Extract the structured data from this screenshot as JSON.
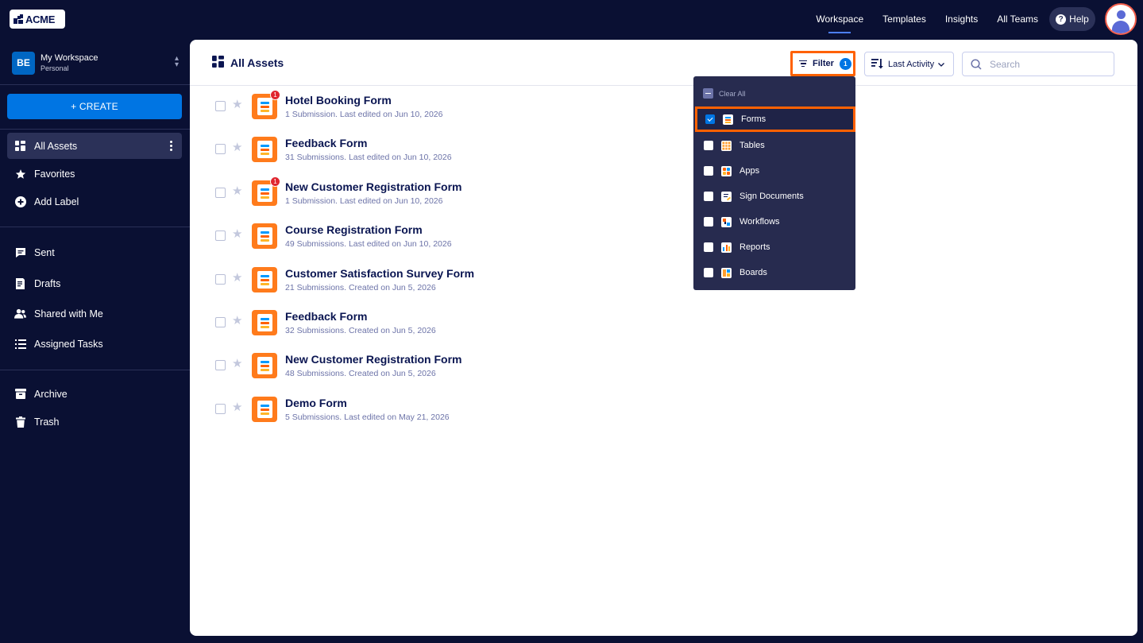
{
  "brand": {
    "logo_text": "ACME"
  },
  "nav": {
    "links": [
      {
        "label": "Workspace",
        "active": true
      },
      {
        "label": "Templates",
        "active": false
      },
      {
        "label": "Insights",
        "active": false
      },
      {
        "label": "All Teams",
        "active": false
      }
    ],
    "help_label": "Help",
    "help_glyph": "?"
  },
  "workspace": {
    "initials": "BE",
    "name": "My Workspace",
    "type": "Personal"
  },
  "sidebar": {
    "create_label": "+ CREATE",
    "items": [
      {
        "label": "All Assets",
        "icon": "grid-icon"
      },
      {
        "label": "Favorites",
        "icon": "star-icon"
      },
      {
        "label": "Add Label",
        "icon": "plus-circle-icon"
      },
      {
        "label": "Sent",
        "icon": "message-icon"
      },
      {
        "label": "Drafts",
        "icon": "draft-icon"
      },
      {
        "label": "Shared with Me",
        "icon": "users-icon"
      },
      {
        "label": "Assigned Tasks",
        "icon": "tasks-icon"
      },
      {
        "label": "Archive",
        "icon": "archive-icon"
      },
      {
        "label": "Trash",
        "icon": "trash-icon"
      }
    ]
  },
  "main": {
    "title": "All Assets",
    "filter_label": "Filter",
    "filter_count": "1",
    "sort_label": "Last Activity",
    "search_placeholder": "Search",
    "assets": [
      {
        "title": "Hotel Booking Form",
        "meta": "1 Submission. Last edited on Jun 10, 2026",
        "badge": "1"
      },
      {
        "title": "Feedback Form",
        "meta": "31 Submissions. Last edited on Jun 10, 2026",
        "badge": ""
      },
      {
        "title": "New Customer Registration Form",
        "meta": "1 Submission. Last edited on Jun 10, 2026",
        "badge": "1"
      },
      {
        "title": "Course Registration Form",
        "meta": "49 Submissions. Last edited on Jun 10, 2026",
        "badge": ""
      },
      {
        "title": "Customer Satisfaction Survey Form",
        "meta": "21 Submissions. Created on Jun 5, 2026",
        "badge": ""
      },
      {
        "title": "Feedback Form",
        "meta": "32 Submissions. Created on Jun 5, 2026",
        "badge": ""
      },
      {
        "title": "New Customer Registration Form",
        "meta": "48 Submissions. Created on Jun 5, 2026",
        "badge": ""
      },
      {
        "title": "Demo Form",
        "meta": "5 Submissions. Last edited on May 21, 2026",
        "badge": ""
      }
    ]
  },
  "filter_menu": {
    "clear_label": "Clear All",
    "options": [
      {
        "label": "Forms",
        "checked": true,
        "icon": "forms-icon"
      },
      {
        "label": "Tables",
        "checked": false,
        "icon": "tables-icon"
      },
      {
        "label": "Apps",
        "checked": false,
        "icon": "apps-icon"
      },
      {
        "label": "Sign Documents",
        "checked": false,
        "icon": "sign-documents-icon"
      },
      {
        "label": "Workflows",
        "checked": false,
        "icon": "workflows-icon"
      },
      {
        "label": "Reports",
        "checked": false,
        "icon": "reports-icon"
      },
      {
        "label": "Boards",
        "checked": false,
        "icon": "boards-icon"
      }
    ]
  },
  "colors": {
    "background": "#0a1033",
    "accent": "#0075e3",
    "highlight": "#ff6100",
    "form_icon": "#ff7b1c",
    "badge": "#e0262f"
  }
}
